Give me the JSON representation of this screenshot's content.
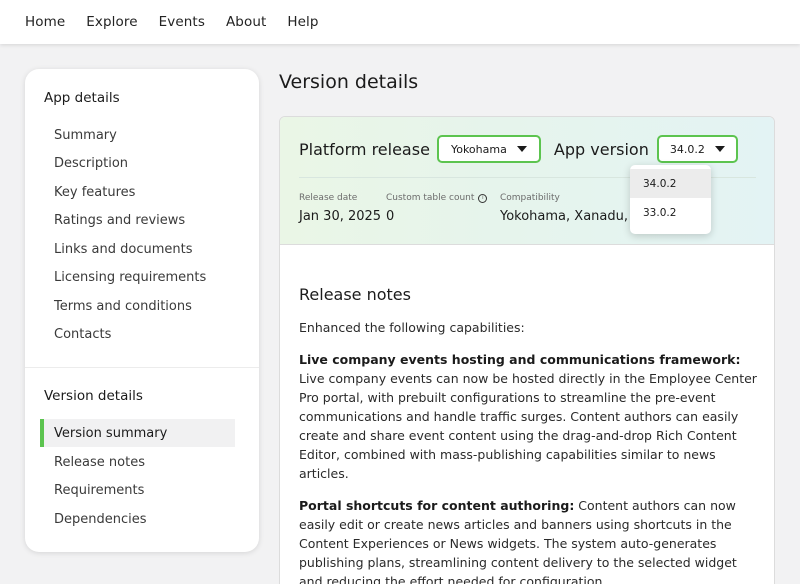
{
  "nav": {
    "items": [
      "Home",
      "Explore",
      "Events",
      "About",
      "Help"
    ]
  },
  "sidebar": {
    "app_details_title": "App details",
    "app_items": [
      "Summary",
      "Description",
      "Key features",
      "Ratings and reviews",
      "Links and documents",
      "Licensing requirements",
      "Terms and conditions",
      "Contacts"
    ],
    "version_details_title": "Version details",
    "version_items": [
      "Version summary",
      "Release notes",
      "Requirements",
      "Dependencies"
    ],
    "active_item": "Version summary"
  },
  "main": {
    "title": "Version details",
    "platform_release_label": "Platform release",
    "platform_release_value": "Yokohama",
    "app_version_label": "App version",
    "app_version_value": "34.0.2",
    "version_options": [
      "34.0.2",
      "33.0.2"
    ],
    "release_date_label": "Release date",
    "release_date_value": "Jan 30, 2025",
    "custom_table_count_label": "Custom table count",
    "custom_table_count_value": "0",
    "compatibility_label": "Compatibility",
    "compatibility_value": "Yokohama, Xanadu, W",
    "release_notes_title": "Release notes",
    "intro": "Enhanced the following capabilities:",
    "para1_bold": "Live company events hosting and communications framework:",
    "para1_text": " Live company events can now be hosted directly in the Employee Center Pro portal, with prebuilt configurations to streamline the pre-event communications and handle traffic surges. Content authors can easily create and share event content using the drag-and-drop Rich Content Editor, combined with mass-publishing capabilities similar to news articles.",
    "para2_bold": "Portal shortcuts for content authoring:",
    "para2_text": " Content authors can now easily edit or create news articles and banners using shortcuts in the Content Experiences or News widgets. The system auto-generates publishing plans, streamlining content delivery to the selected widget and reducing the effort needed for configuration."
  },
  "colors": {
    "accent_green": "#5cc44f",
    "page_bg": "#f2f2f3"
  }
}
